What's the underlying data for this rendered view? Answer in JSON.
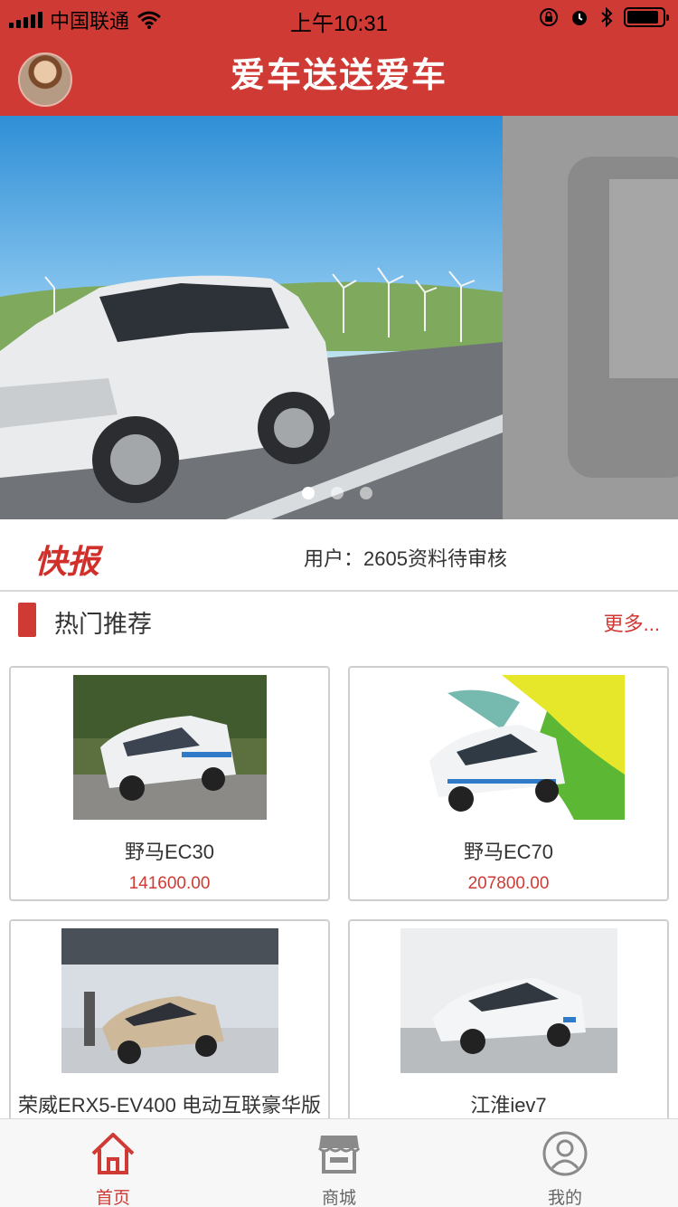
{
  "status_bar": {
    "carrier": "中国联通",
    "time": "上午10:31",
    "battery_level": 0.9
  },
  "header": {
    "title": "爱车送送爱车"
  },
  "banner": {
    "slide_count": 3,
    "active_index": 0
  },
  "ticker": {
    "logo": "快报",
    "message": "用户：2605资料待审核"
  },
  "section": {
    "title": "热门推荐",
    "more_label": "更多..."
  },
  "products": [
    {
      "name": "野马EC30",
      "price": "141600.00"
    },
    {
      "name": "野马EC70",
      "price": "207800.00"
    },
    {
      "name": "荣威ERX5-EV400 电动互联豪华版",
      "price": ""
    },
    {
      "name": "江淮iev7",
      "price": ""
    }
  ],
  "tabbar": {
    "tabs": [
      {
        "label": "首页",
        "icon": "home-icon",
        "active": true
      },
      {
        "label": "商城",
        "icon": "store-icon",
        "active": false
      },
      {
        "label": "我的",
        "icon": "profile-icon",
        "active": false
      }
    ]
  },
  "colors": {
    "brand": "#cf3a34",
    "text": "#333333",
    "border": "#cfcfcf",
    "tabbar_bg": "#f7f7f7"
  }
}
